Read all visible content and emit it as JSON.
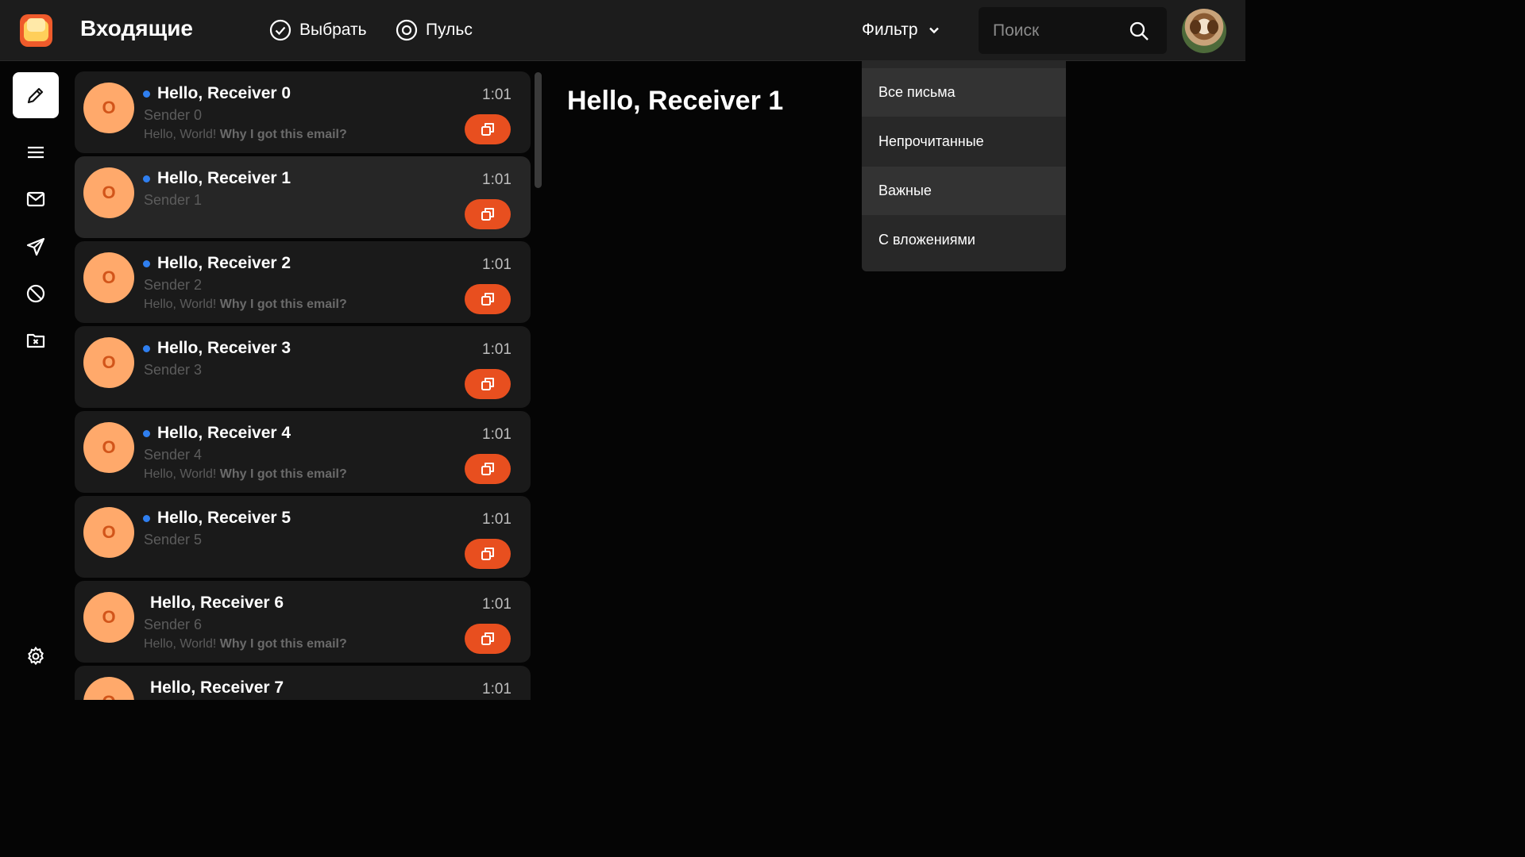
{
  "header": {
    "title": "Входящие",
    "select_label": "Выбрать",
    "pulse_label": "Пульс",
    "filter_label": "Фильтр",
    "search_placeholder": "Поиск"
  },
  "filter_menu": [
    {
      "label": "Все письма"
    },
    {
      "label": "Непрочитанные"
    },
    {
      "label": "Важные"
    },
    {
      "label": "С вложениями"
    }
  ],
  "sidebar": {
    "items": [
      {
        "icon": "pencil-icon",
        "active": true
      },
      {
        "icon": "menu-icon"
      },
      {
        "icon": "envelope-icon"
      },
      {
        "icon": "send-icon"
      },
      {
        "icon": "block-icon"
      },
      {
        "icon": "folder-x-icon"
      },
      {
        "icon": "gear-icon"
      }
    ]
  },
  "mails": [
    {
      "avatar": "O",
      "subject": "Hello, Receiver 0",
      "sender": "Sender 0",
      "time": "1:01",
      "preview_plain": "Hello, World!",
      "preview_bold": "Why I got this email?",
      "unread": true
    },
    {
      "avatar": "O",
      "subject": "Hello, Receiver 1",
      "sender": "Sender 1",
      "time": "1:01",
      "unread": true,
      "selected": true
    },
    {
      "avatar": "O",
      "subject": "Hello, Receiver 2",
      "sender": "Sender 2",
      "time": "1:01",
      "preview_plain": "Hello, World!",
      "preview_bold": "Why I got this email?",
      "unread": true
    },
    {
      "avatar": "O",
      "subject": "Hello, Receiver 3",
      "sender": "Sender 3",
      "time": "1:01",
      "unread": true
    },
    {
      "avatar": "O",
      "subject": "Hello, Receiver 4",
      "sender": "Sender 4",
      "time": "1:01",
      "preview_plain": "Hello, World!",
      "preview_bold": "Why I got this email?",
      "unread": true
    },
    {
      "avatar": "O",
      "subject": "Hello, Receiver 5",
      "sender": "Sender 5",
      "time": "1:01",
      "unread": true
    },
    {
      "avatar": "O",
      "subject": "Hello, Receiver 6",
      "sender": "Sender 6",
      "time": "1:01",
      "preview_plain": "Hello, World!",
      "preview_bold": "Why I got this email?",
      "unread": false
    },
    {
      "avatar": "O",
      "subject": "Hello, Receiver 7",
      "sender": "",
      "time": "1:01",
      "unread": false
    }
  ],
  "reader": {
    "title": "Hello, Receiver 1"
  },
  "colors": {
    "accent": "#e84f1f",
    "avatar_bg": "#ffa96b",
    "unread_dot": "#2f7ff0"
  }
}
